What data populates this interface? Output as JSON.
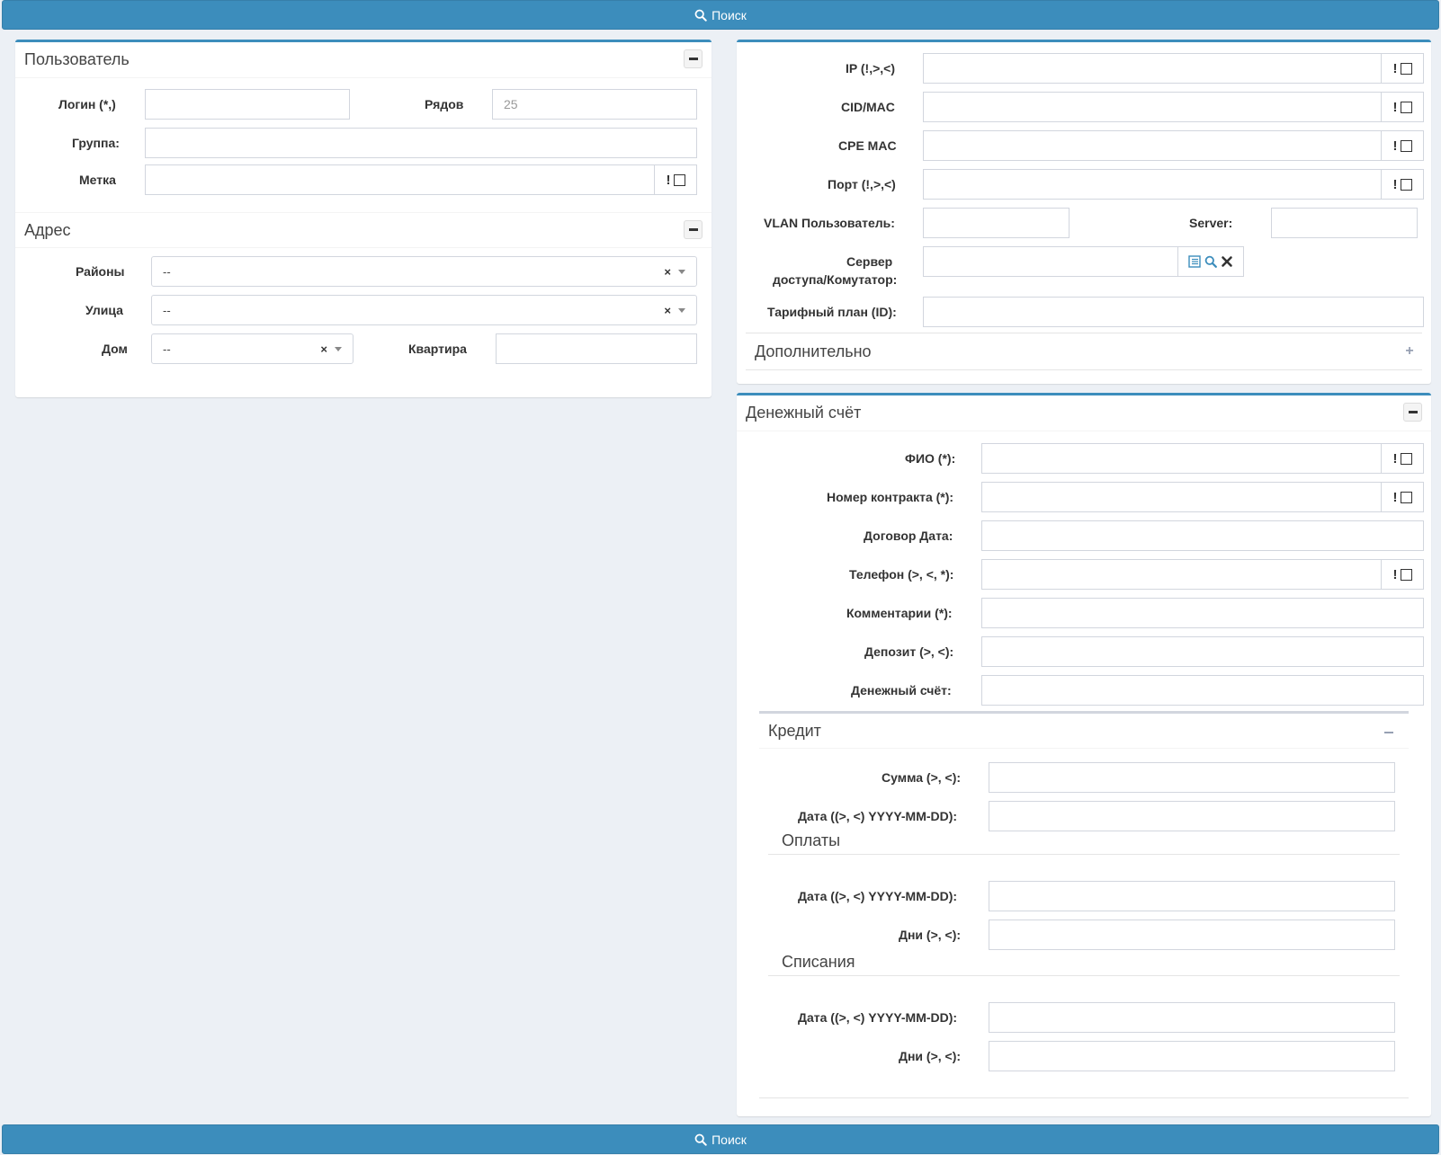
{
  "search_button": "Поиск",
  "user_panel": {
    "title": "Пользователь",
    "login_label": "Логин (*,)",
    "rows_label": "Рядов",
    "rows_placeholder": "25",
    "group_label": "Группа:",
    "tag_label": "Метка",
    "excl": "!"
  },
  "address_panel": {
    "title": "Адрес",
    "district_label": "Районы",
    "district_value": "--",
    "street_label": "Улица",
    "street_value": "--",
    "house_label": "Дом",
    "house_value": "--",
    "flat_label": "Квартира",
    "clear": "×"
  },
  "network_panel": {
    "ip_label": "IP (!,>,<)",
    "cid_label": "CID/MAC",
    "cpe_label": "CPE MAC",
    "port_label": "Порт (!,>,<)",
    "vlan_label": "VLAN Пользователь:",
    "server_label": "Server:",
    "nas_label_1": "Сервер",
    "nas_label_2": "доступа/Комутатор:",
    "tariff_label": "Тарифный план (ID):",
    "extra_title": "Дополнительно",
    "extra_toggle": "+",
    "excl": "!"
  },
  "account_panel": {
    "title": "Денежный счёт",
    "fio_label": "ФИО (*):",
    "contract_label": "Номер контракта (*):",
    "contract_date_label": "Договор Дата:",
    "phone_label": "Телефон (>, <, *):",
    "comment_label": "Комментарии (*):",
    "deposit_label": "Депозит (>, <):",
    "account_label": "Денежный счёт:",
    "excl": "!"
  },
  "credit_panel": {
    "title": "Кредит",
    "sum_label": "Сумма (>, <):",
    "date_label": "Дата ((>, <) YYYY-MM-DD):"
  },
  "payments_section": {
    "title": "Оплаты",
    "date_label": "Дата ((>, <) YYYY-MM-DD):",
    "days_label": "Дни (>, <):"
  },
  "fees_section": {
    "title": "Списания",
    "date_label": "Дата ((>, <) YYYY-MM-DD):",
    "days_label": "Дни (>, <):"
  },
  "colors": {
    "primary": "#3c8dbc",
    "background": "#ecf0f5",
    "border": "#d2d6de"
  }
}
